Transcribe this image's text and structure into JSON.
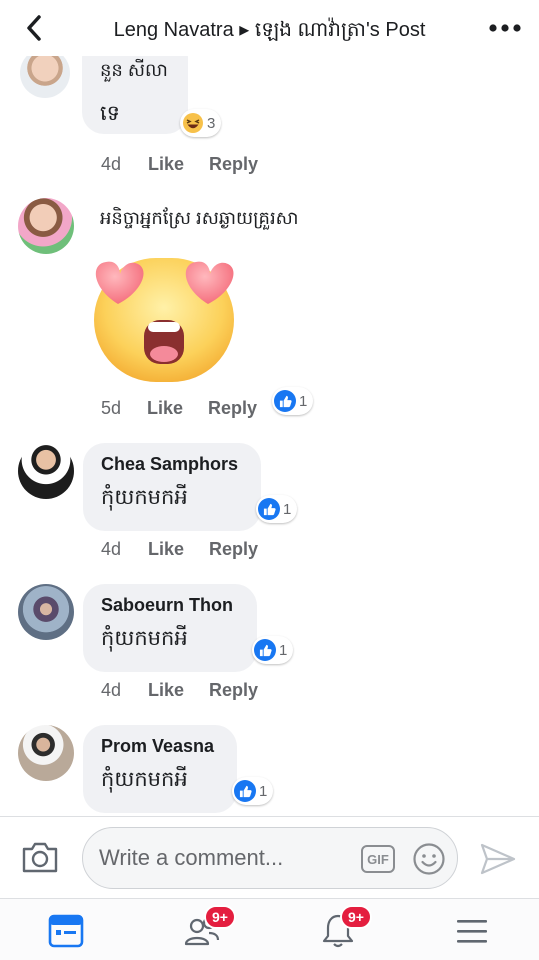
{
  "header": {
    "title": "Leng Navatra ▸ ឡេង ណាវ៉ាត្រា's Post"
  },
  "comments": [
    {
      "author": "នួន សីលា",
      "text": "ទេ",
      "reaction": {
        "type": "haha",
        "count": "3"
      },
      "time": "4d",
      "like_label": "Like",
      "reply_label": "Reply"
    },
    {
      "author": "អនិច្ចាអ្នកស្រែ រសឆ្ងាយគ្រួរសា",
      "sticker": "heart-eyes-emoji",
      "reaction": {
        "type": "like",
        "count": "1"
      },
      "time": "5d",
      "like_label": "Like",
      "reply_label": "Reply"
    },
    {
      "author": "Chea Samphors",
      "text": "កុំយកមកអី",
      "reaction": {
        "type": "like",
        "count": "1"
      },
      "time": "4d",
      "like_label": "Like",
      "reply_label": "Reply"
    },
    {
      "author": "Saboeurn Thon",
      "text": "កុំយកមកអី",
      "reaction": {
        "type": "like",
        "count": "1"
      },
      "time": "4d",
      "like_label": "Like",
      "reply_label": "Reply"
    },
    {
      "author": "Prom Veasna",
      "text": "កុំយកមកអី",
      "reaction": {
        "type": "like",
        "count": "1"
      }
    }
  ],
  "composer": {
    "placeholder": "Write a comment...",
    "gif_label": "GIF"
  },
  "tabbar": {
    "friends_badge": "9+",
    "notifications_badge": "9+"
  },
  "colors": {
    "accent": "#1877f2",
    "badge": "#e41e3f",
    "bubble": "#f0f1f4"
  }
}
